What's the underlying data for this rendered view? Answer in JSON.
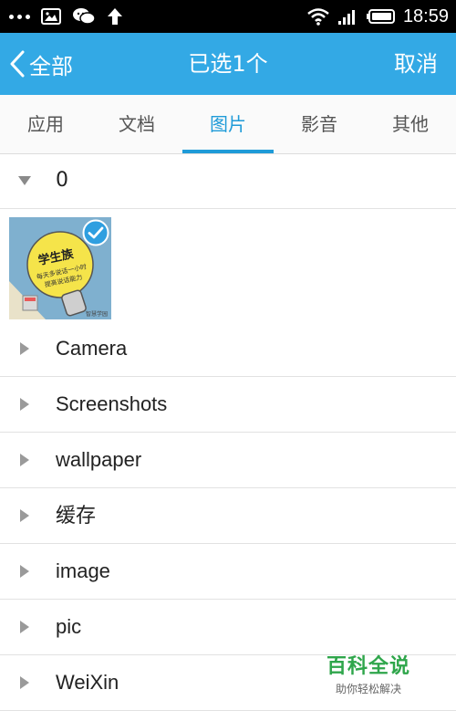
{
  "status_bar": {
    "time": "18:59",
    "icons": [
      "more-dots-icon",
      "image-notification-icon",
      "wechat-icon",
      "upload-arrow-icon",
      "wifi-icon",
      "signal-icon",
      "battery-icon"
    ]
  },
  "header": {
    "back_label": "全部",
    "title": "已选1个",
    "cancel_label": "取消",
    "bg_color": "#33a9e5"
  },
  "tabs": [
    {
      "label": "应用",
      "active": false
    },
    {
      "label": "文档",
      "active": false
    },
    {
      "label": "图片",
      "active": true
    },
    {
      "label": "影音",
      "active": false
    },
    {
      "label": "其他",
      "active": false
    }
  ],
  "group": {
    "label": "0",
    "expanded": true,
    "selected_image_checked": true,
    "thumbnail_text": {
      "headline": "学生族",
      "line1": "每天多说话一小时",
      "line2": "提高说话能力",
      "corner": "智慧学园"
    }
  },
  "folders": [
    {
      "label": "Camera"
    },
    {
      "label": "Screenshots"
    },
    {
      "label": "wallpaper"
    },
    {
      "label": "缓存"
    },
    {
      "label": "image"
    },
    {
      "label": "pic"
    },
    {
      "label": "WeiXin"
    }
  ],
  "watermark": {
    "title": "百科全说",
    "subtitle": "助你轻松解决"
  }
}
